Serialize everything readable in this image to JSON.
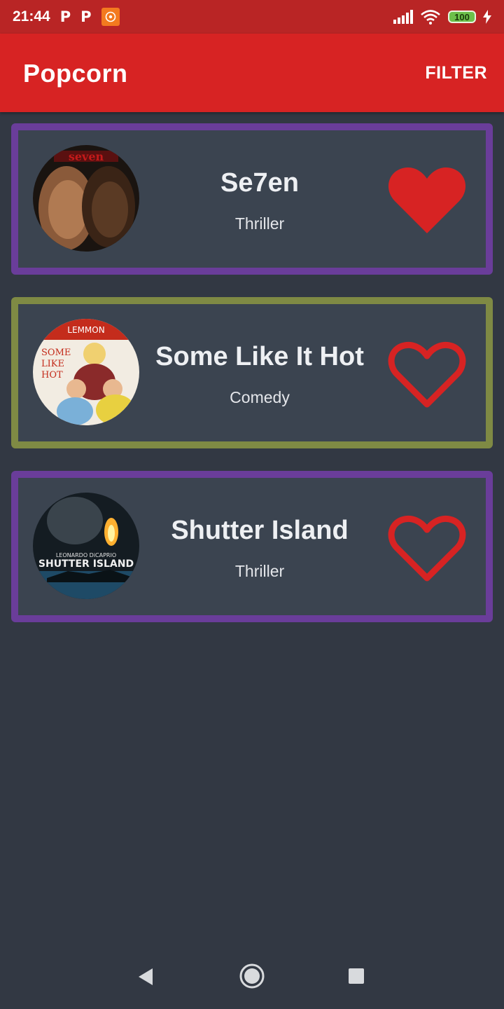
{
  "status_bar": {
    "time": "21:44",
    "notifications": [
      "p-icon",
      "p-icon",
      "app-notification-icon"
    ],
    "icons": [
      "signal-icon",
      "wifi-icon",
      "battery-icon",
      "charging-icon"
    ],
    "battery": "100"
  },
  "app_bar": {
    "title": "Popcorn",
    "filter_label": "FILTER",
    "color": "#d72323"
  },
  "movies": [
    {
      "title": "Se7en",
      "genre": "Thriller",
      "favorite": true,
      "border_color": "#6a3d9a"
    },
    {
      "title": "Some Like It Hot",
      "genre": "Comedy",
      "favorite": false,
      "border_color": "#7f8a44"
    },
    {
      "title": "Shutter Island",
      "genre": "Thriller",
      "favorite": false,
      "border_color": "#6a3d9a"
    }
  ],
  "nav_bar": {
    "icons": [
      "back-icon",
      "home-icon",
      "recents-icon"
    ]
  },
  "colors": {
    "background": "#323843",
    "card": "#3b4450",
    "heart": "#d72323"
  }
}
